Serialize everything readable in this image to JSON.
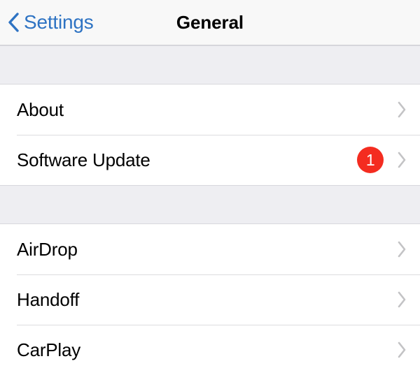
{
  "navbar": {
    "back_label": "Settings",
    "back_icon": "chevron-left-icon",
    "title": "General",
    "background": "#f8f8f8",
    "tint_color": "#2e73c3"
  },
  "sections": [
    {
      "id": "device-section",
      "rows": [
        {
          "label": "About",
          "badge": null,
          "disclosure_icon": "chevron-right-icon"
        },
        {
          "label": "Software Update",
          "badge": "1",
          "badge_color": "#f42c20",
          "disclosure_icon": "chevron-right-icon"
        }
      ]
    },
    {
      "id": "continuity-section",
      "rows": [
        {
          "label": "AirDrop",
          "badge": null,
          "disclosure_icon": "chevron-right-icon"
        },
        {
          "label": "Handoff",
          "badge": null,
          "disclosure_icon": "chevron-right-icon"
        },
        {
          "label": "CarPlay",
          "badge": null,
          "disclosure_icon": "chevron-right-icon"
        }
      ]
    }
  ],
  "colors": {
    "group_background": "#eeeef2",
    "row_background": "#ffffff",
    "separator": "#dcdcdf",
    "chevron_gray": "#c3c3c5",
    "label_text": "#000000"
  }
}
